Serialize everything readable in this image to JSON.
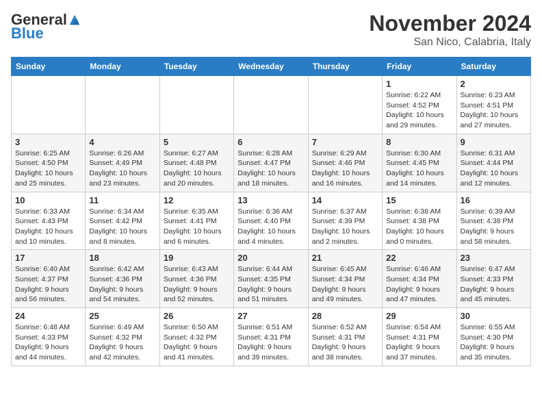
{
  "header": {
    "logo_general": "General",
    "logo_blue": "Blue",
    "title": "November 2024",
    "subtitle": "San Nico, Calabria, Italy"
  },
  "columns": [
    "Sunday",
    "Monday",
    "Tuesday",
    "Wednesday",
    "Thursday",
    "Friday",
    "Saturday"
  ],
  "weeks": [
    [
      {
        "day": "",
        "info": ""
      },
      {
        "day": "",
        "info": ""
      },
      {
        "day": "",
        "info": ""
      },
      {
        "day": "",
        "info": ""
      },
      {
        "day": "",
        "info": ""
      },
      {
        "day": "1",
        "info": "Sunrise: 6:22 AM\nSunset: 4:52 PM\nDaylight: 10 hours and 29 minutes."
      },
      {
        "day": "2",
        "info": "Sunrise: 6:23 AM\nSunset: 4:51 PM\nDaylight: 10 hours and 27 minutes."
      }
    ],
    [
      {
        "day": "3",
        "info": "Sunrise: 6:25 AM\nSunset: 4:50 PM\nDaylight: 10 hours and 25 minutes."
      },
      {
        "day": "4",
        "info": "Sunrise: 6:26 AM\nSunset: 4:49 PM\nDaylight: 10 hours and 23 minutes."
      },
      {
        "day": "5",
        "info": "Sunrise: 6:27 AM\nSunset: 4:48 PM\nDaylight: 10 hours and 20 minutes."
      },
      {
        "day": "6",
        "info": "Sunrise: 6:28 AM\nSunset: 4:47 PM\nDaylight: 10 hours and 18 minutes."
      },
      {
        "day": "7",
        "info": "Sunrise: 6:29 AM\nSunset: 4:46 PM\nDaylight: 10 hours and 16 minutes."
      },
      {
        "day": "8",
        "info": "Sunrise: 6:30 AM\nSunset: 4:45 PM\nDaylight: 10 hours and 14 minutes."
      },
      {
        "day": "9",
        "info": "Sunrise: 6:31 AM\nSunset: 4:44 PM\nDaylight: 10 hours and 12 minutes."
      }
    ],
    [
      {
        "day": "10",
        "info": "Sunrise: 6:33 AM\nSunset: 4:43 PM\nDaylight: 10 hours and 10 minutes."
      },
      {
        "day": "11",
        "info": "Sunrise: 6:34 AM\nSunset: 4:42 PM\nDaylight: 10 hours and 8 minutes."
      },
      {
        "day": "12",
        "info": "Sunrise: 6:35 AM\nSunset: 4:41 PM\nDaylight: 10 hours and 6 minutes."
      },
      {
        "day": "13",
        "info": "Sunrise: 6:36 AM\nSunset: 4:40 PM\nDaylight: 10 hours and 4 minutes."
      },
      {
        "day": "14",
        "info": "Sunrise: 6:37 AM\nSunset: 4:39 PM\nDaylight: 10 hours and 2 minutes."
      },
      {
        "day": "15",
        "info": "Sunrise: 6:38 AM\nSunset: 4:38 PM\nDaylight: 10 hours and 0 minutes."
      },
      {
        "day": "16",
        "info": "Sunrise: 6:39 AM\nSunset: 4:38 PM\nDaylight: 9 hours and 58 minutes."
      }
    ],
    [
      {
        "day": "17",
        "info": "Sunrise: 6:40 AM\nSunset: 4:37 PM\nDaylight: 9 hours and 56 minutes."
      },
      {
        "day": "18",
        "info": "Sunrise: 6:42 AM\nSunset: 4:36 PM\nDaylight: 9 hours and 54 minutes."
      },
      {
        "day": "19",
        "info": "Sunrise: 6:43 AM\nSunset: 4:36 PM\nDaylight: 9 hours and 52 minutes."
      },
      {
        "day": "20",
        "info": "Sunrise: 6:44 AM\nSunset: 4:35 PM\nDaylight: 9 hours and 51 minutes."
      },
      {
        "day": "21",
        "info": "Sunrise: 6:45 AM\nSunset: 4:34 PM\nDaylight: 9 hours and 49 minutes."
      },
      {
        "day": "22",
        "info": "Sunrise: 6:46 AM\nSunset: 4:34 PM\nDaylight: 9 hours and 47 minutes."
      },
      {
        "day": "23",
        "info": "Sunrise: 6:47 AM\nSunset: 4:33 PM\nDaylight: 9 hours and 45 minutes."
      }
    ],
    [
      {
        "day": "24",
        "info": "Sunrise: 6:48 AM\nSunset: 4:33 PM\nDaylight: 9 hours and 44 minutes."
      },
      {
        "day": "25",
        "info": "Sunrise: 6:49 AM\nSunset: 4:32 PM\nDaylight: 9 hours and 42 minutes."
      },
      {
        "day": "26",
        "info": "Sunrise: 6:50 AM\nSunset: 4:32 PM\nDaylight: 9 hours and 41 minutes."
      },
      {
        "day": "27",
        "info": "Sunrise: 6:51 AM\nSunset: 4:31 PM\nDaylight: 9 hours and 39 minutes."
      },
      {
        "day": "28",
        "info": "Sunrise: 6:52 AM\nSunset: 4:31 PM\nDaylight: 9 hours and 38 minutes."
      },
      {
        "day": "29",
        "info": "Sunrise: 6:54 AM\nSunset: 4:31 PM\nDaylight: 9 hours and 37 minutes."
      },
      {
        "day": "30",
        "info": "Sunrise: 6:55 AM\nSunset: 4:30 PM\nDaylight: 9 hours and 35 minutes."
      }
    ]
  ]
}
